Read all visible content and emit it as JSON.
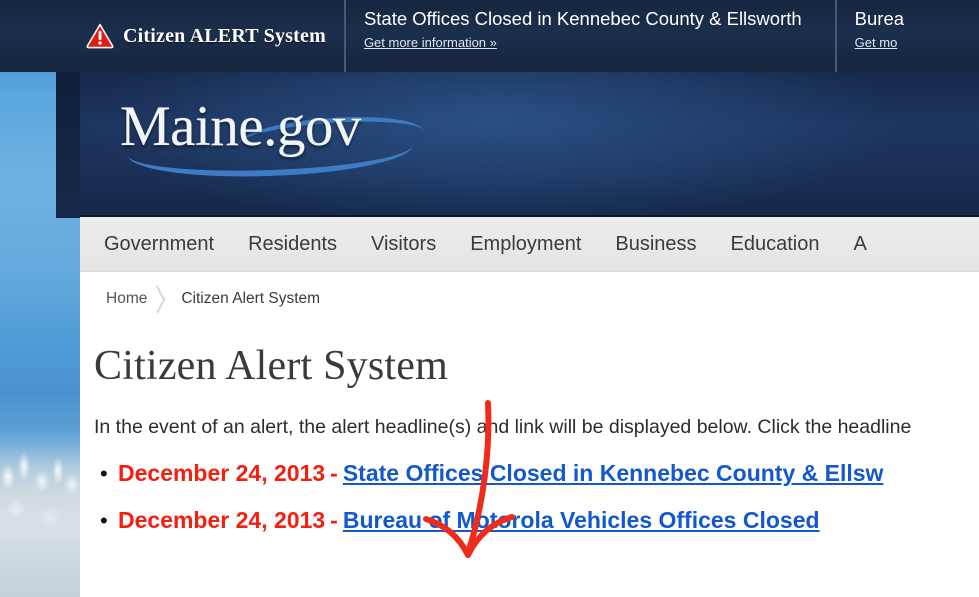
{
  "alert_bar": {
    "brand_label": "Citizen ALERT System",
    "warning_icon": "warning-triangle-icon",
    "items": [
      {
        "title": "State Offices Closed in Kennebec County & Ellsworth",
        "link": "Get more information »"
      },
      {
        "title": "Burea",
        "link": "Get mo"
      }
    ]
  },
  "header": {
    "logo_text": "Maine.gov"
  },
  "nav": {
    "items": [
      {
        "label": "Government"
      },
      {
        "label": "Residents"
      },
      {
        "label": "Visitors"
      },
      {
        "label": "Employment"
      },
      {
        "label": "Business"
      },
      {
        "label": "Education"
      },
      {
        "label": "A"
      }
    ]
  },
  "breadcrumb": {
    "home": "Home",
    "current": "Citizen Alert System"
  },
  "content": {
    "page_title": "Citizen Alert System",
    "intro": "In the event of an alert, the alert headline(s) and link will be displayed below. Click the headline",
    "alerts": [
      {
        "bullet": "•",
        "date": "December 24, 2013",
        "dash": "-",
        "link": "State Offices Closed in Kennebec County & Ellsw"
      },
      {
        "bullet": "•",
        "date": "December 24, 2013",
        "dash": "-",
        "link": "Bureau of Motorola Vehicles Offices Closed"
      }
    ]
  },
  "annotation": {
    "type": "red-arrow",
    "color": "#ef2b1c",
    "points_to": "Bureau of Motorola Vehicles Offices Closed"
  },
  "colors": {
    "alert_bar_bg": "#16263f",
    "header_navy": "#1d3560",
    "nav_bg": "#e8e8e8",
    "date_red": "#f31f11",
    "link_blue": "#1358cc",
    "warning_red": "#e01b0f"
  }
}
